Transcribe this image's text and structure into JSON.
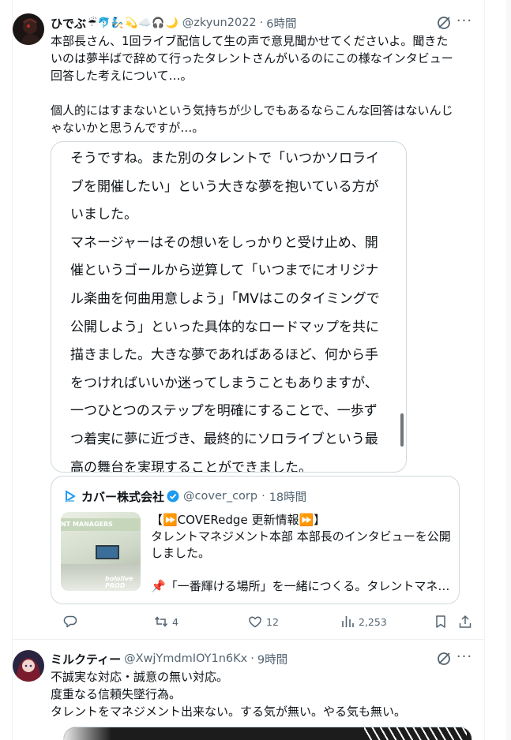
{
  "tweet1": {
    "display_name": "ひでぶ",
    "emojis": "☔🐬🧞💫☁️🎧🌙",
    "handle": "@zkyun2022",
    "time": "6時間",
    "more": "···",
    "body": "本部長さん、1回ライブ配信して生の声で意見聞かせてくださいよ。聞きた\nいのは夢半ばで辞めて行ったタレントさんがいるのにこの様なインタビュー\n回答した考えについて…。\n\n個人的にはすまないという気持ちが少しでもあるならこんな回答はないんじ\nゃないかと思うんですが…。",
    "long_text": "そうですね。また別のタレントで「いつかソロライ\nブを開催したい」という大きな夢を抱いている方が\nいました。\nマネージャーはその想いをしっかりと受け止め、開\n催というゴールから逆算して「いつまでにオリジナ\nル楽曲を何曲用意しよう」「MVはこのタイミングで\n公開しよう」といった具体的なロードマップを共に\n描きました。大きな夢であればあるほど、何から手\nをつければいいか迷ってしまうこともありますが、\n一つひとつのステップを明確にすることで、一歩ず\nつ着実に夢に近づき、最終的にソロライブという最\n高の舞台を実現することができました。",
    "quote": {
      "name": "カバー株式会社",
      "handle": "@cover_corp",
      "time": "18時間",
      "thumb_band": "NT MANAGERS",
      "thumb_brand": "hololive PROD",
      "text": "【⏩COVERedge 更新情報⏩】\nタレントマネジメント本部 本部長のインタビューを公開\nしました。",
      "last_line": "📌「一番輝ける場所」を一緒につくる。タレントマネジメント本部"
    },
    "actions": {
      "reply_count": "",
      "retweet_count": "4",
      "like_count": "12",
      "views_count": "2,253"
    }
  },
  "tweet2": {
    "display_name": "ミルクティー",
    "handle": "@XwjYmdmIOY1n6Kx",
    "time": "9時間",
    "more": "···",
    "body": "不誠実な対応・誠意の無い対応。\n度重なる信頼失墜行為。\nタレントをマネジメント出来ない。する気が無い。やる気も無い。"
  },
  "colors": {
    "text": "#0f1419",
    "secondary": "#536471",
    "border": "#cfd9de",
    "verified": "#1d9bf0"
  }
}
